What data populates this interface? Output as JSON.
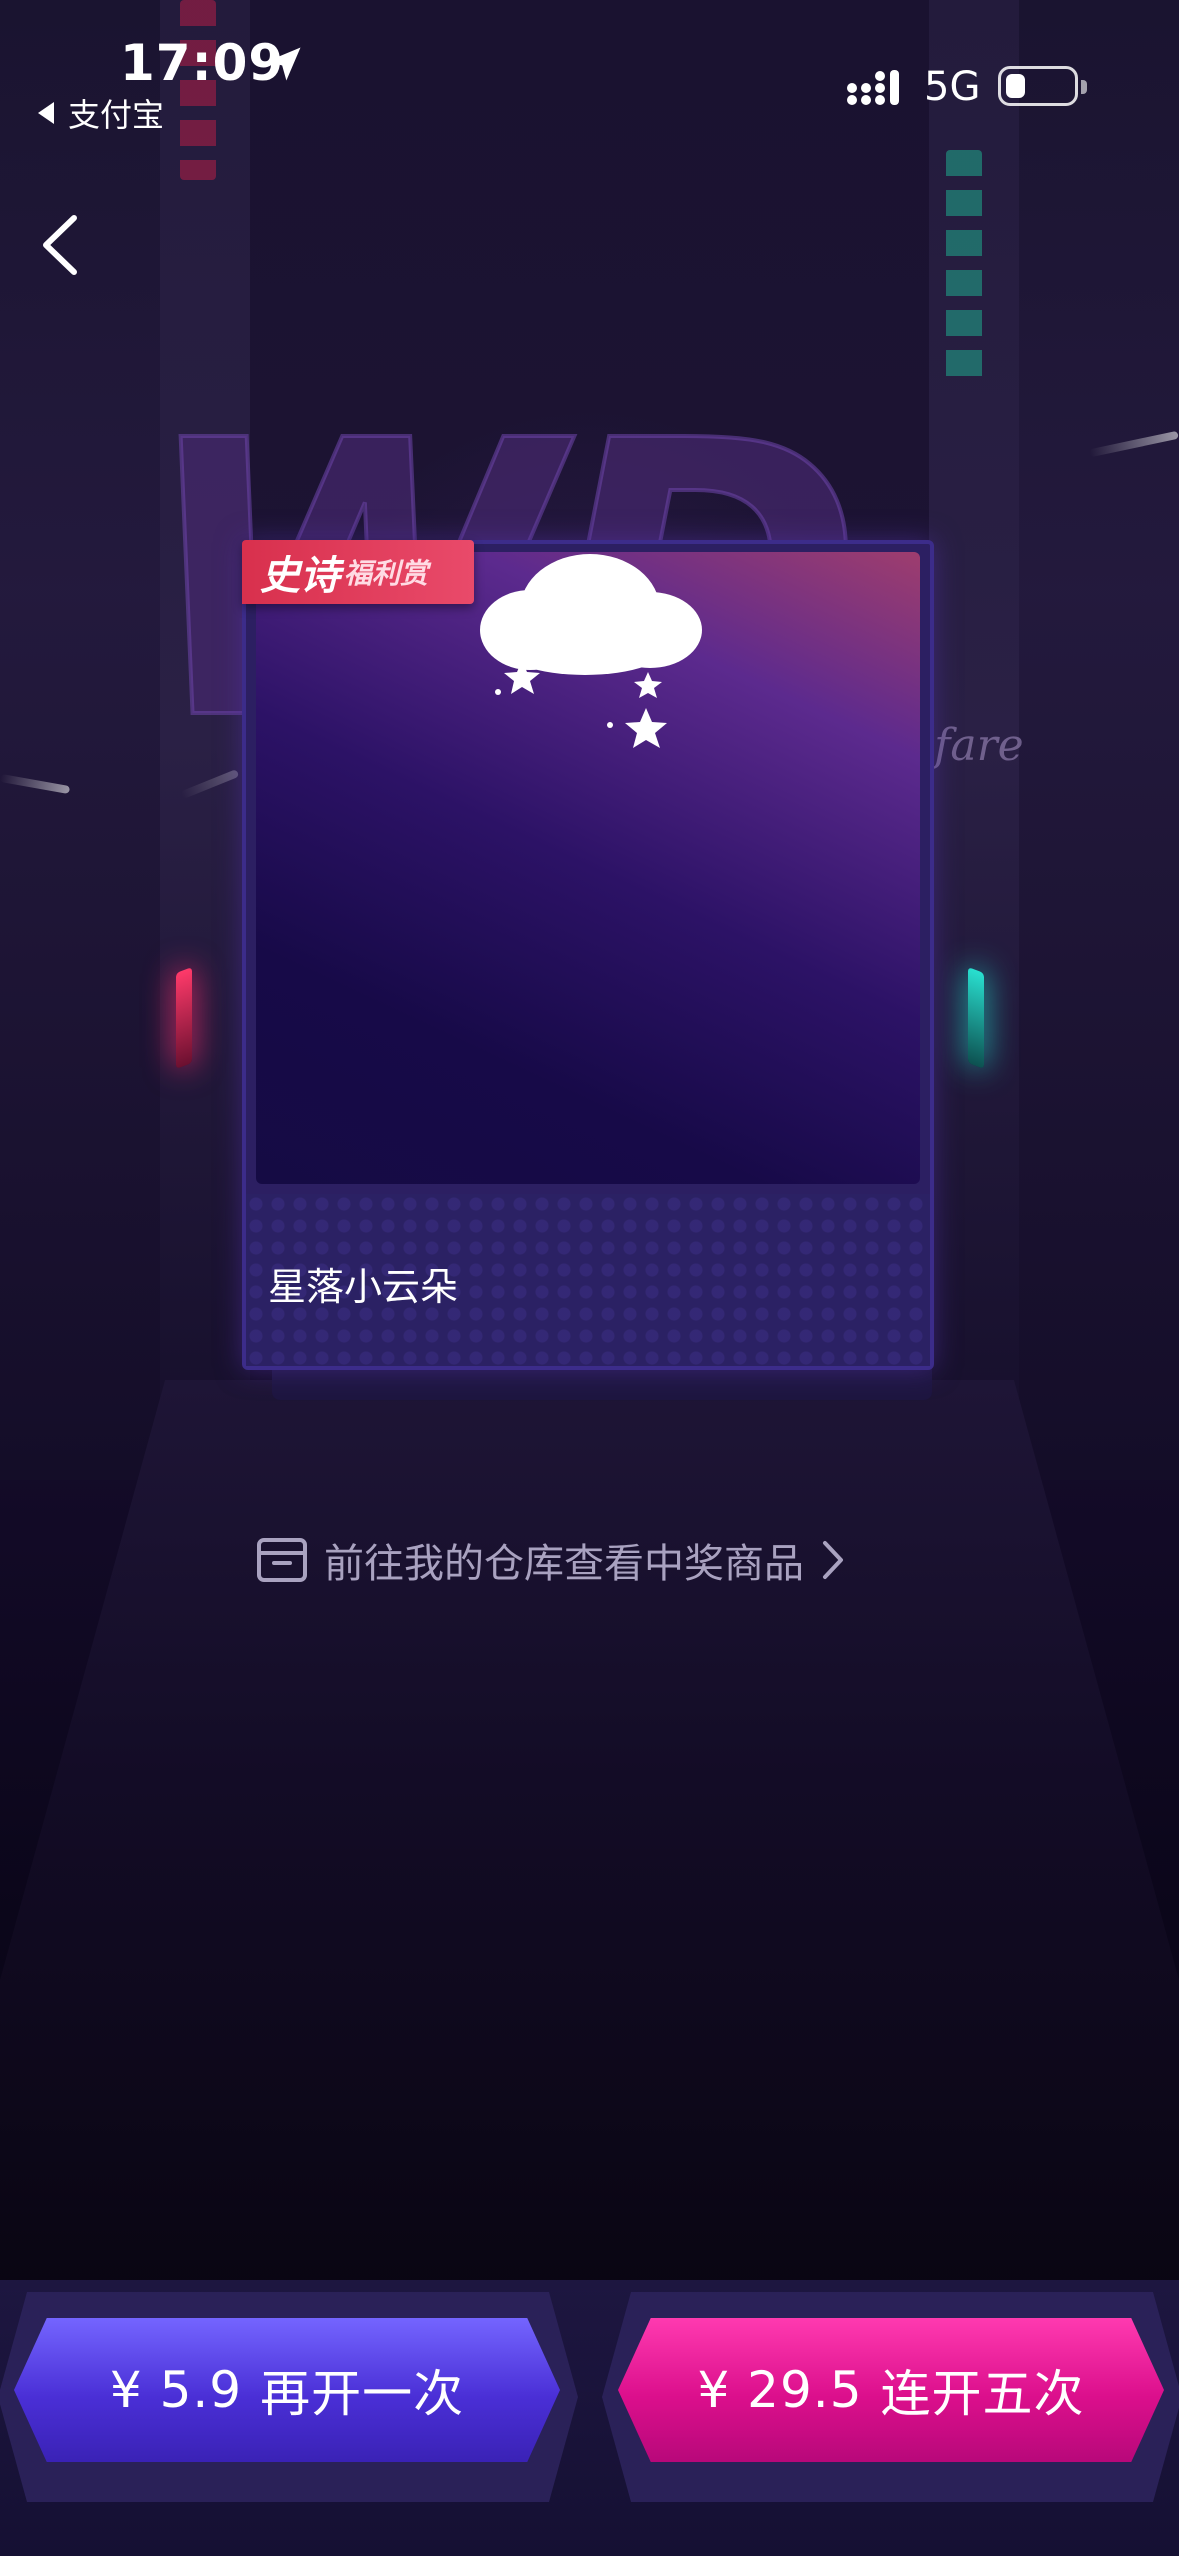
{
  "status_bar": {
    "time": "17:09",
    "back_app": "支付宝",
    "network": "5G",
    "battery_level": 0.3
  },
  "card": {
    "badge_main": "史诗",
    "badge_sub": "福利赏",
    "prize_name": "星落小云朵"
  },
  "warehouse_link": {
    "label": "前往我的仓库查看中奖商品"
  },
  "buttons": {
    "single": {
      "price": "¥ 5.9",
      "label": "再开一次",
      "color": "#4a2fd6"
    },
    "five": {
      "price": "¥ 29.5",
      "label": "连开五次",
      "color": "#db0f8c"
    }
  },
  "background": {
    "wordmark": "WD",
    "script_text": "lfare"
  }
}
